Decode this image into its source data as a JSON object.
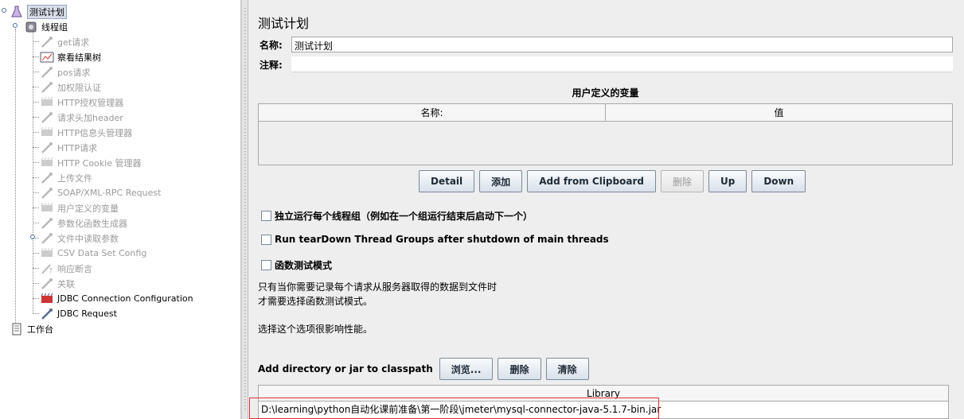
{
  "tree": {
    "items": [
      {
        "label": "测试计划",
        "icon": "flask-icon",
        "depth": 0,
        "disabled": false,
        "selected": true
      },
      {
        "label": "线程组",
        "icon": "gear-spool-icon",
        "depth": 1,
        "disabled": false,
        "selected": false
      },
      {
        "label": "get请求",
        "icon": "pipette-icon",
        "depth": 2,
        "disabled": true,
        "selected": false
      },
      {
        "label": "察看结果树",
        "icon": "chart-icon",
        "depth": 2,
        "disabled": false,
        "selected": false
      },
      {
        "label": "pos请求",
        "icon": "pipette-icon",
        "depth": 2,
        "disabled": true,
        "selected": false
      },
      {
        "label": "加权限认证",
        "icon": "pipette-icon",
        "depth": 2,
        "disabled": true,
        "selected": false
      },
      {
        "label": "HTTP授权管理器",
        "icon": "config-icon",
        "depth": 2,
        "disabled": true,
        "selected": false
      },
      {
        "label": "请求头加header",
        "icon": "pipette-icon",
        "depth": 2,
        "disabled": true,
        "selected": false
      },
      {
        "label": "HTTP信息头管理器",
        "icon": "config-icon",
        "depth": 2,
        "disabled": true,
        "selected": false
      },
      {
        "label": "HTTP请求",
        "icon": "pipette-icon",
        "depth": 2,
        "disabled": true,
        "selected": false
      },
      {
        "label": "HTTP Cookie 管理器",
        "icon": "config-icon",
        "depth": 2,
        "disabled": true,
        "selected": false
      },
      {
        "label": "上传文件",
        "icon": "pipette-icon",
        "depth": 2,
        "disabled": true,
        "selected": false
      },
      {
        "label": "SOAP/XML-RPC Request",
        "icon": "pipette-icon",
        "depth": 2,
        "disabled": true,
        "selected": false
      },
      {
        "label": "用户定义的变量",
        "icon": "config-icon",
        "depth": 2,
        "disabled": true,
        "selected": false
      },
      {
        "label": "参数化函数生成器",
        "icon": "pipette-icon",
        "depth": 2,
        "disabled": true,
        "selected": false
      },
      {
        "label": "文件中读取参数",
        "icon": "pipette-icon",
        "depth": 2,
        "disabled": true,
        "selected": false
      },
      {
        "label": "CSV Data Set Config",
        "icon": "config-icon",
        "depth": 2,
        "disabled": true,
        "selected": false
      },
      {
        "label": "响应断言",
        "icon": "assertion-icon",
        "depth": 2,
        "disabled": true,
        "selected": false
      },
      {
        "label": "关联",
        "icon": "pipette-icon",
        "depth": 2,
        "disabled": true,
        "selected": false
      },
      {
        "label": "JDBC Connection Configuration",
        "icon": "jdbc-config-icon",
        "depth": 2,
        "disabled": false,
        "selected": false
      },
      {
        "label": "JDBC Request",
        "icon": "pipette-icon",
        "depth": 2,
        "disabled": false,
        "selected": false
      },
      {
        "label": "工作台",
        "icon": "workbench-icon",
        "depth": 0,
        "disabled": false,
        "selected": false
      }
    ]
  },
  "main": {
    "title": "测试计划",
    "name_label": "名称:",
    "name_value": "测试计划",
    "comment_label": "注释:",
    "comment_value": "",
    "vars_title": "用户定义的变量",
    "vars_col_name": "名称:",
    "vars_col_value": "值",
    "buttons": {
      "detail": "Detail",
      "add": "添加",
      "add_clipboard": "Add from Clipboard",
      "delete": "删除",
      "up": "Up",
      "down": "Down"
    },
    "checkboxes": {
      "serialize": "独立运行每个线程组（例如在一个组运行结束后启动下一个）",
      "teardown": "Run tearDown Thread Groups after shutdown of main threads",
      "functional": "函数测试模式"
    },
    "notes": {
      "line1": "只有当你需要记录每个请求从服务器取得的数据到文件时",
      "line2": "才需要选择函数测试模式。",
      "line3": "选择这个选项很影响性能。"
    },
    "classpath": {
      "label": "Add directory or jar to classpath",
      "browse": "浏览...",
      "delete": "删除",
      "clear": "清除",
      "library_header": "Library",
      "library_value": "D:\\learning\\python自动化课前准备\\第一阶段\\jmeter\\mysql-connector-java-5.1.7-bin.jar"
    }
  },
  "colors": {
    "highlight_box": "#e03030",
    "disabled_text": "#9a9a9a"
  }
}
